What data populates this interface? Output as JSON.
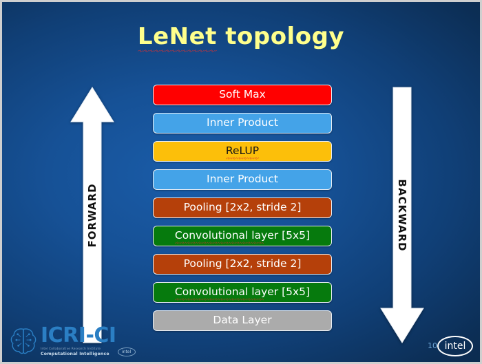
{
  "slide": {
    "title_main": "LeNet",
    "title_rest": " topology",
    "page_number": "10",
    "background_color": "#16539b",
    "title_color": "#ffff8c"
  },
  "layers": [
    {
      "label": "Soft Max",
      "bg": "#ff0000",
      "fg": "#ffffff",
      "squiggle": "none"
    },
    {
      "label": "Inner Product",
      "bg": "#44a3e8",
      "fg": "#ffffff",
      "squiggle": "none"
    },
    {
      "label": "ReLUP",
      "bg": "#fcbf0a",
      "fg": "#141414",
      "squiggle": "full"
    },
    {
      "label": "Inner Product",
      "bg": "#44a3e8",
      "fg": "#ffffff",
      "squiggle": "none"
    },
    {
      "label": "Pooling [2x2, stride 2]",
      "bg": "#b5400a",
      "fg": "#ffffff",
      "squiggle": "none"
    },
    {
      "label": "Convolutional layer [5x5]",
      "bg": "#067a0d",
      "fg": "#ffffff",
      "squiggle": "partial"
    },
    {
      "label": "Pooling [2x2, stride 2]",
      "bg": "#b5400a",
      "fg": "#ffffff",
      "squiggle": "none"
    },
    {
      "label": "Convolutional layer [5x5]",
      "bg": "#067a0d",
      "fg": "#ffffff",
      "squiggle": "partial"
    },
    {
      "label": "Data Layer",
      "bg": "#ababab",
      "fg": "#ffffff",
      "squiggle": "none"
    }
  ],
  "arrows": {
    "forward": {
      "label": "FORWARD",
      "direction": "up",
      "color": "#ffffff"
    },
    "backward": {
      "label": "BACKWARD",
      "direction": "down",
      "color": "#ffffff"
    }
  },
  "footer": {
    "icri_name": "ICRI-CI",
    "icri_sub1": "Intel Collaborative Research Institute",
    "icri_sub2": "Computational Intelligence",
    "icri_intel_badge": "intel",
    "intel_logo": "intel"
  }
}
